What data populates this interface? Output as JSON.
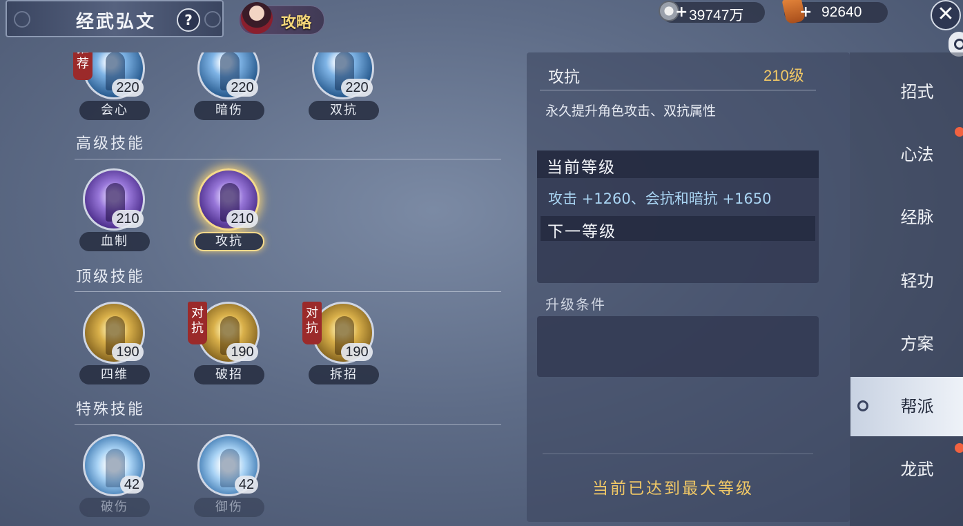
{
  "header": {
    "title": "经武弘文",
    "help": "?",
    "guide_label": "攻略",
    "currency1": "39747万",
    "currency2": "92640",
    "close": "✕"
  },
  "skills": {
    "top_row": [
      {
        "name": "会心",
        "level": "220",
        "badge": "推荐"
      },
      {
        "name": "暗伤",
        "level": "220"
      },
      {
        "name": "双抗",
        "level": "220"
      }
    ],
    "advanced": {
      "title": "高级技能",
      "items": [
        {
          "name": "血制",
          "level": "210"
        },
        {
          "name": "攻抗",
          "level": "210"
        }
      ]
    },
    "top": {
      "title": "顶级技能",
      "items": [
        {
          "name": "四维",
          "level": "190"
        },
        {
          "name": "破招",
          "level": "190",
          "badge": "对抗"
        },
        {
          "name": "拆招",
          "level": "190",
          "badge": "对抗"
        }
      ]
    },
    "special": {
      "title": "特殊技能",
      "items": [
        {
          "name": "破伤",
          "level": "42"
        },
        {
          "name": "御伤",
          "level": "42"
        }
      ]
    }
  },
  "detail": {
    "name": "攻抗",
    "level": "210级",
    "description": "永久提升角色攻击、双抗属性",
    "current_header": "当前等级",
    "current_stat": "攻击 +1260、会抗和暗抗 +1650",
    "next_header": "下一等级",
    "requirements_header": "升级条件",
    "max_notice": "当前已达到最大等级"
  },
  "tabs": [
    "招式",
    "心法",
    "经脉",
    "轻功",
    "方案",
    "帮派",
    "龙武"
  ],
  "active_tab": "帮派",
  "colors": {
    "accent_gold": "#f1c866",
    "badge_red": "#9b2a2a",
    "notify_dot": "#f26240"
  }
}
